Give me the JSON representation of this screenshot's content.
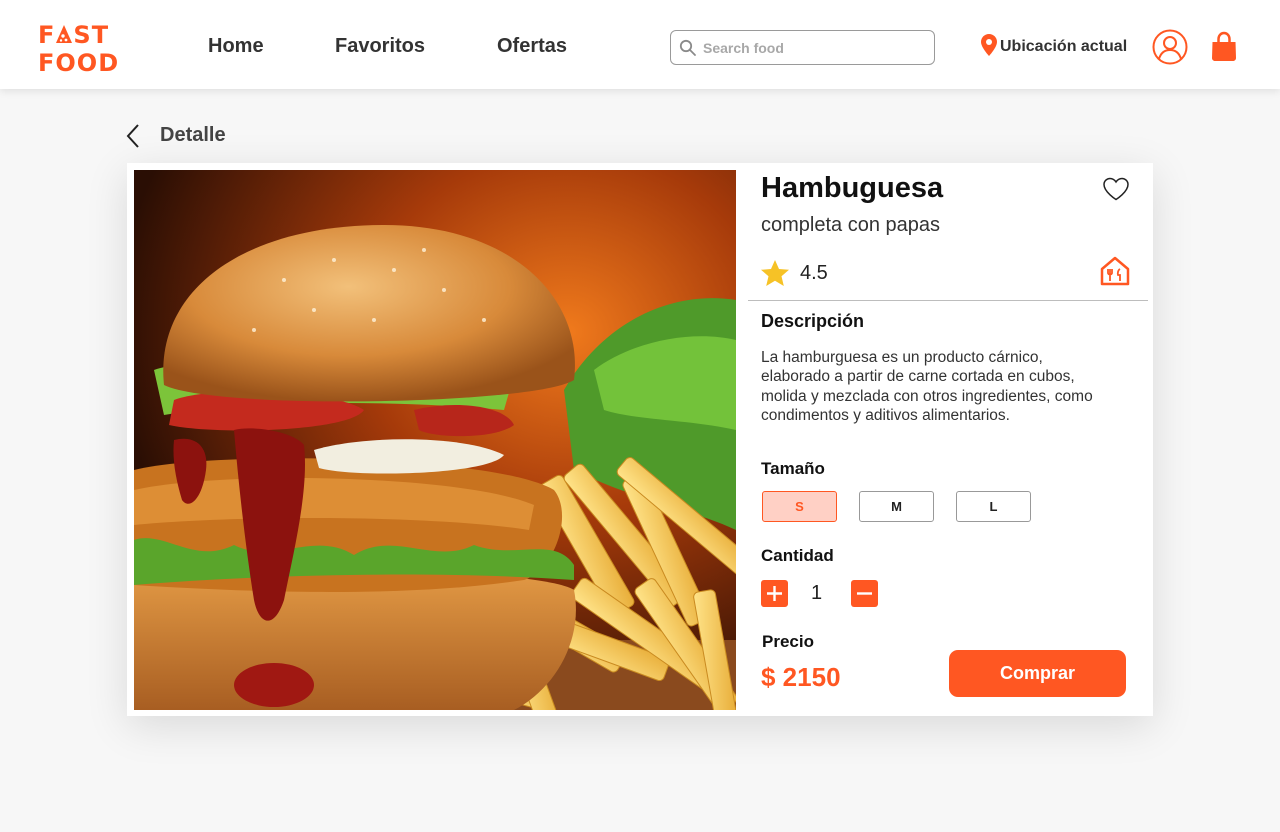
{
  "brand": {
    "logo_line1_a": "F",
    "logo_line1_b": "ST",
    "logo_line2": "FOOD",
    "accent_color": "#ff5722"
  },
  "nav": {
    "home": "Home",
    "favoritos": "Favoritos",
    "ofertas": "Ofertas"
  },
  "search": {
    "placeholder": "Search food",
    "value": ""
  },
  "location": {
    "label": "Ubicación actual"
  },
  "icons": {
    "search": "search-icon",
    "location": "location-pin-icon",
    "user": "user-icon",
    "cart": "shopping-bag-icon",
    "back": "chevron-left-icon",
    "favorite": "heart-icon",
    "rating": "star-icon",
    "restaurant": "restaurant-icon",
    "plus": "plus-icon",
    "minus": "minus-icon"
  },
  "page": {
    "title": "Detalle"
  },
  "product": {
    "name": "Hambuguesa",
    "subtitle": "completa con papas",
    "rating": "4.5",
    "description_label": "Descripción",
    "description": "La hamburguesa es un producto cárnico, elaborado a partir de carne cortada en cubos, molida y mezclada con otros ingredientes, como condimentos y aditivos alimentarios.",
    "size_label": "Tamaño",
    "sizes": [
      "S",
      "M",
      "L"
    ],
    "selected_size": "S",
    "quantity_label": "Cantidad",
    "quantity": "1",
    "price_label": "Precio",
    "price": "$ 2150",
    "buy_label": "Comprar"
  }
}
